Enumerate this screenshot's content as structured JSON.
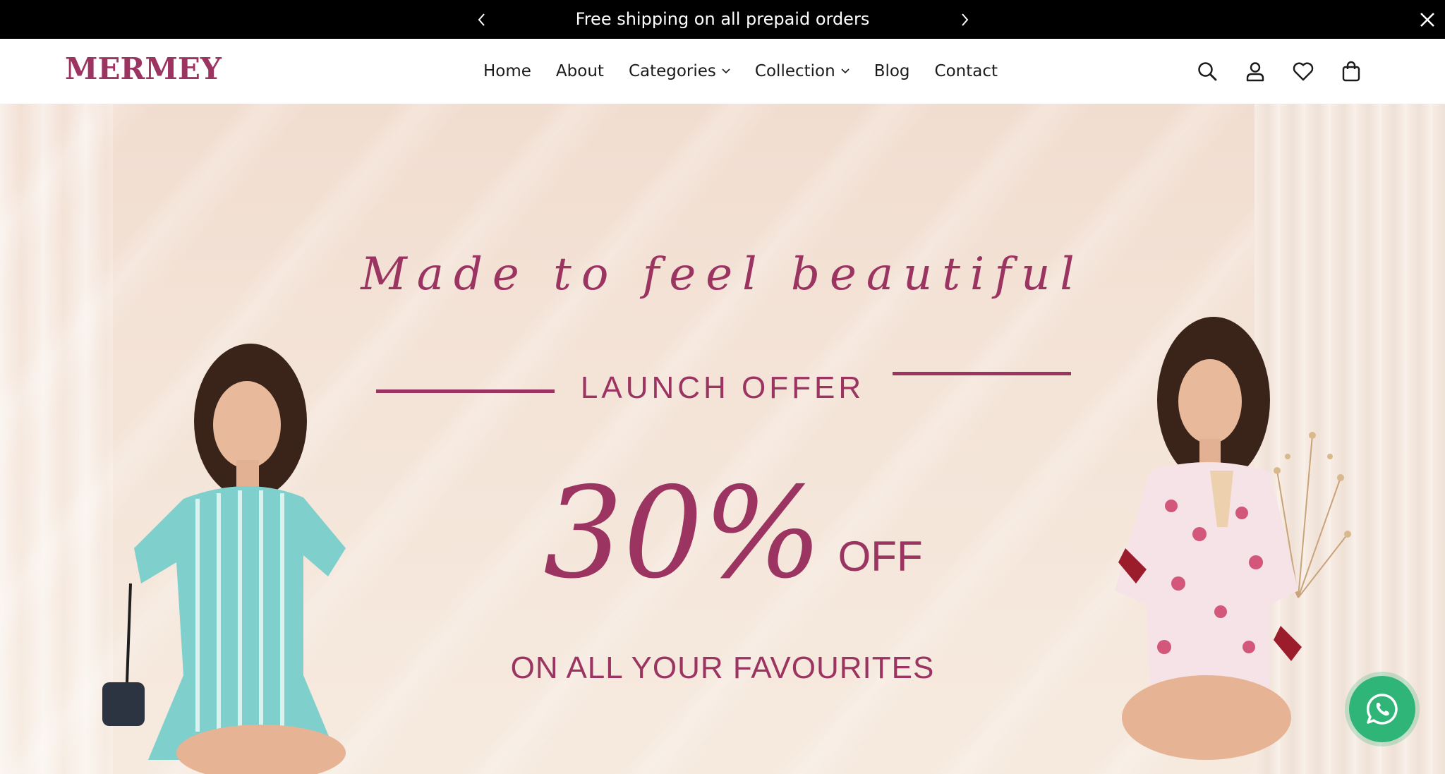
{
  "announcement": {
    "text": "Free shipping on all prepaid orders",
    "prev_icon": "chevron-left-icon",
    "next_icon": "chevron-right-icon",
    "close_icon": "close-icon"
  },
  "header": {
    "logo": "MERMEY",
    "nav": [
      {
        "label": "Home",
        "has_dropdown": false
      },
      {
        "label": "About",
        "has_dropdown": false
      },
      {
        "label": "Categories",
        "has_dropdown": true
      },
      {
        "label": "Collection",
        "has_dropdown": true
      },
      {
        "label": "Blog",
        "has_dropdown": false
      },
      {
        "label": "Contact",
        "has_dropdown": false
      }
    ],
    "icons": [
      "search-icon",
      "account-icon",
      "wishlist-icon",
      "cart-icon"
    ]
  },
  "hero": {
    "tagline": "Made to feel beautiful",
    "offer_label": "LAUNCH OFFER",
    "discount": "30%",
    "off": "OFF",
    "subtitle": "ON ALL YOUR FAVOURITES"
  },
  "floating": {
    "whatsapp_icon": "whatsapp-icon"
  },
  "colors": {
    "brand": "#9c3462",
    "announcement_bg": "#000000",
    "hero_bg": "#f4e4d8",
    "whatsapp": "#2fb578"
  }
}
